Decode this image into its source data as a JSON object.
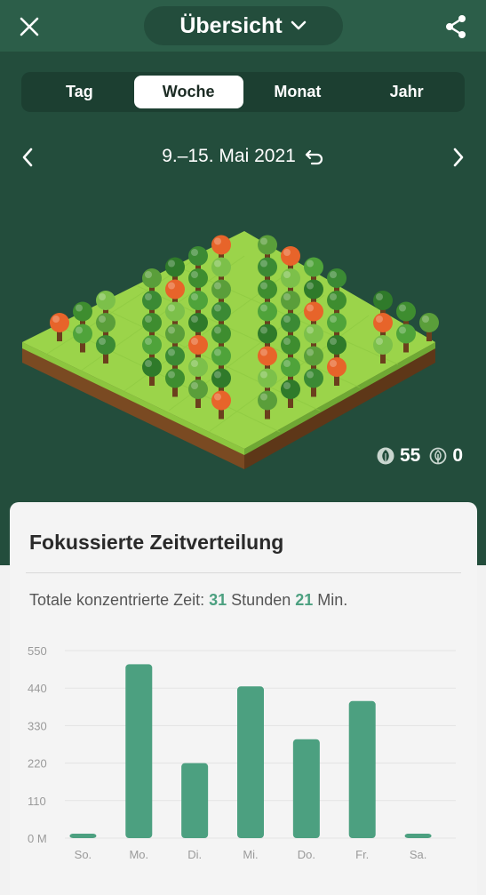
{
  "header": {
    "title": "Übersicht",
    "close_icon": "close-icon",
    "share_icon": "share-icon"
  },
  "tabs": [
    {
      "label": "Tag",
      "active": false
    },
    {
      "label": "Woche",
      "active": true
    },
    {
      "label": "Monat",
      "active": false
    },
    {
      "label": "Jahr",
      "active": false
    }
  ],
  "date": {
    "range": "9.–15. Mai 2021"
  },
  "forest": {
    "alive_count": "55",
    "dead_count": "0"
  },
  "card": {
    "title": "Fokussierte Zeitverteilung",
    "total_prefix": "Totale konzentrierte Zeit:",
    "hours": "31",
    "hours_unit": "Stunden",
    "minutes": "21",
    "minutes_unit": "Min."
  },
  "colors": {
    "header_bg": "#2c5e49",
    "bg": "#234d3c",
    "accent": "#4ca080"
  },
  "chart_data": {
    "type": "bar",
    "categories": [
      "So.",
      "Mo.",
      "Di.",
      "Mi.",
      "Do.",
      "Fr.",
      "Sa."
    ],
    "values": [
      10,
      510,
      220,
      445,
      290,
      402,
      10
    ],
    "y_ticks": [
      "0 M",
      "110",
      "220",
      "330",
      "440",
      "550"
    ],
    "ylim": [
      0,
      550
    ],
    "grid": true
  }
}
